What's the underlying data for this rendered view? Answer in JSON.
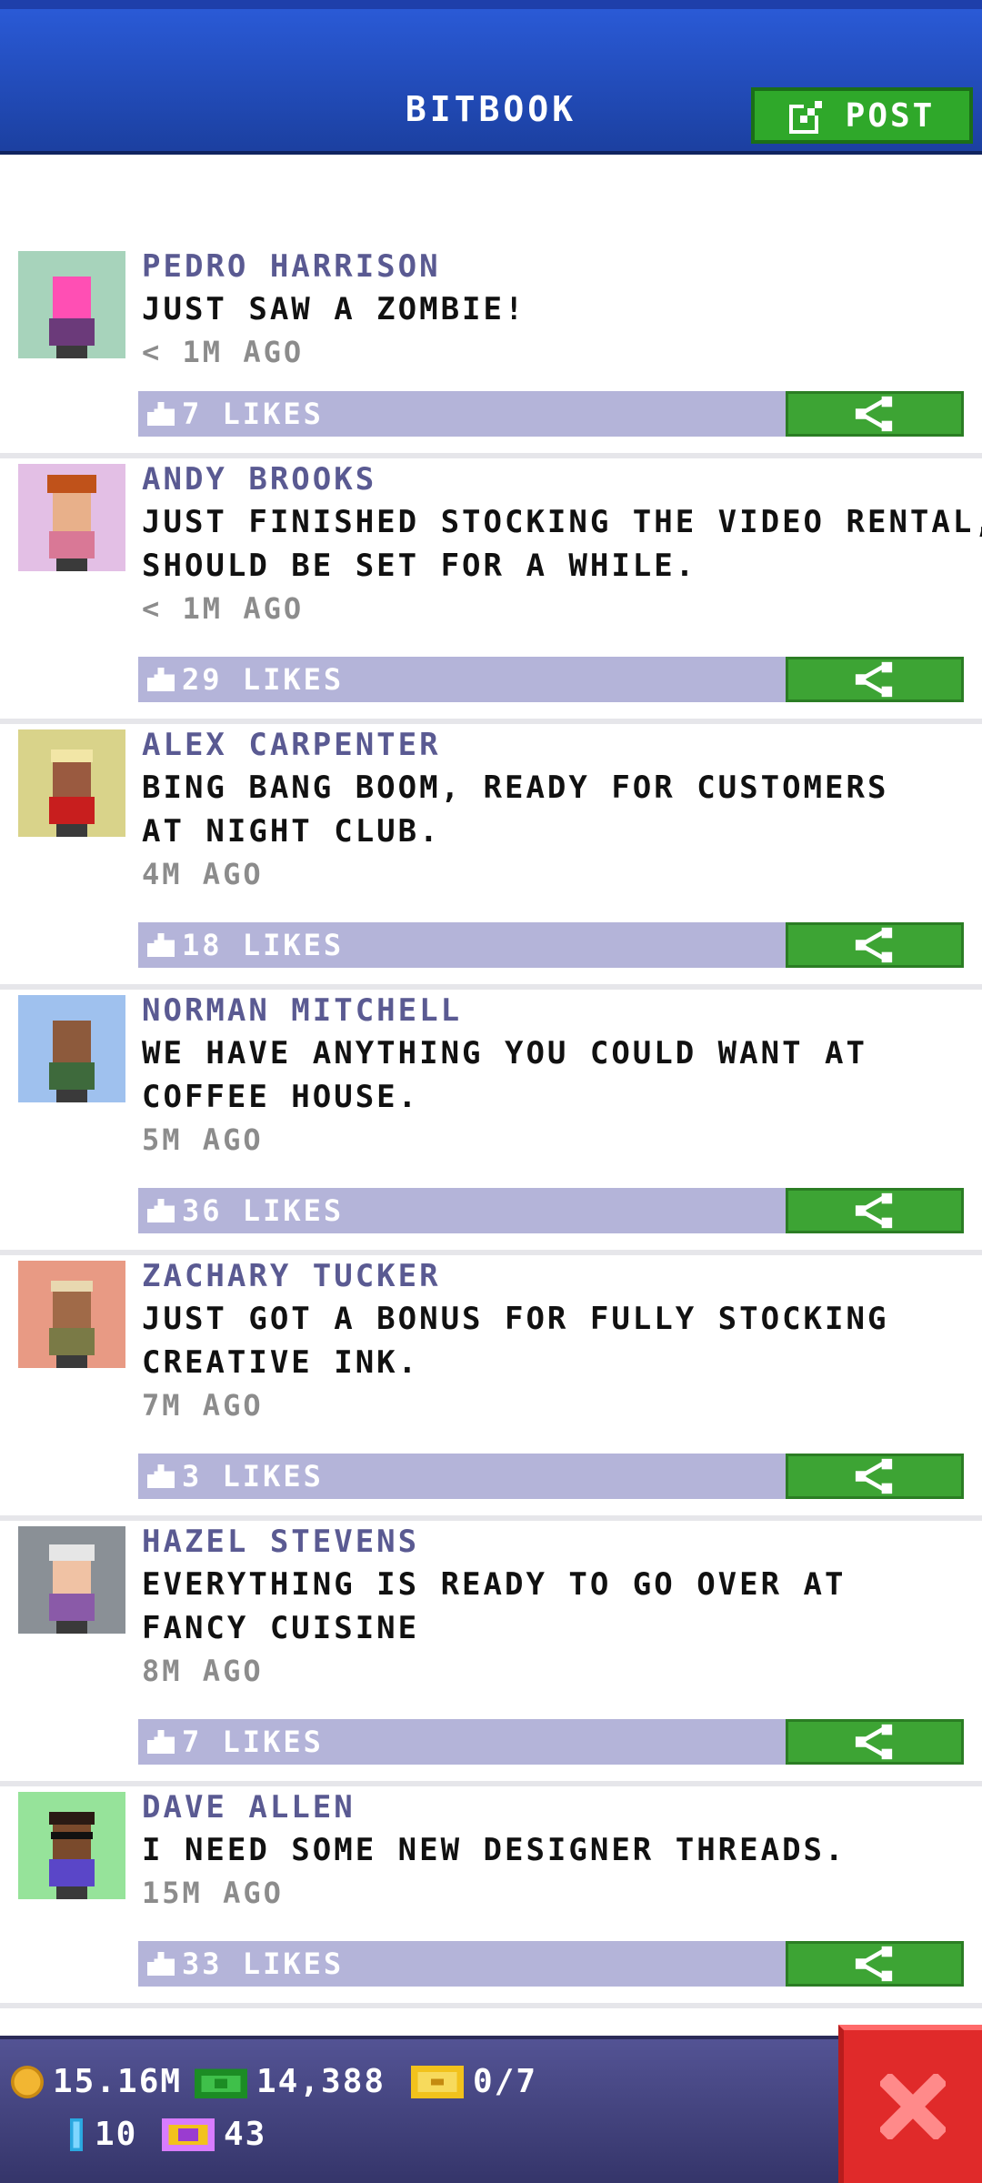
{
  "header": {
    "title": "BITBOOK",
    "post_button_label": "POST",
    "post_icon": "edit-icon"
  },
  "posts": [
    {
      "author": "PEDRO HARRISON",
      "lines": [
        "JUST SAW A ZOMBIE!"
      ],
      "time": "< 1M AGO",
      "likes": "7 LIKES",
      "avatar_bg": "#a7d3bb",
      "hair": "#ff4fb4",
      "skin": "#f4b6a0",
      "shirt": "#6b3a7a"
    },
    {
      "author": "ANDY BROOKS",
      "lines": [
        "JUST FINISHED STOCKING THE VIDEO RENTAL,",
        "SHOULD BE SET FOR A WHILE."
      ],
      "time": "< 1M AGO",
      "likes": "29 LIKES",
      "avatar_bg": "#e3bfe5",
      "hair": "#c0521a",
      "skin": "#e8b08a",
      "shirt": "#d97896"
    },
    {
      "author": "ALEX CARPENTER",
      "lines": [
        "BING BANG BOOM, READY FOR CUSTOMERS",
        "AT NIGHT CLUB."
      ],
      "time": "4M AGO",
      "likes": "18 LIKES",
      "avatar_bg": "#d9d38a",
      "hair": "#f2e6a6",
      "skin": "#9a5a40",
      "shirt": "#c81e1e"
    },
    {
      "author": "NORMAN MITCHELL",
      "lines": [
        "WE HAVE ANYTHING YOU COULD WANT AT",
        "COFFEE HOUSE."
      ],
      "time": "5M AGO",
      "likes": "36 LIKES",
      "avatar_bg": "#9fc1ee",
      "hair": "#7a4a30",
      "skin": "#8d5a3c",
      "shirt": "#3e6a3c"
    },
    {
      "author": "ZACHARY TUCKER",
      "lines": [
        "JUST GOT A BONUS FOR FULLY STOCKING",
        "CREATIVE INK."
      ],
      "time": "7M AGO",
      "likes": "3 LIKES",
      "avatar_bg": "#e89a84",
      "hair": "#e8d8b0",
      "skin": "#a06a48",
      "shirt": "#7a7a46"
    },
    {
      "author": "HAZEL STEVENS",
      "lines": [
        "EVERYTHING IS READY TO GO OVER AT",
        "FANCY CUISINE"
      ],
      "time": "8M AGO",
      "likes": "7 LIKES",
      "avatar_bg": "#8a9096",
      "hair": "#e6e6e6",
      "skin": "#f0c2a4",
      "shirt": "#8a5aa8"
    },
    {
      "author": "DAVE ALLEN",
      "lines": [
        "I NEED SOME NEW DESIGNER THREADS."
      ],
      "time": "15M AGO",
      "likes": "33 LIKES",
      "avatar_bg": "#96e39a",
      "hair": "#2a1a14",
      "skin": "#7a4a2c",
      "shirt": "#5a46c8"
    }
  ],
  "bottom_bar": {
    "coins": "15.16M",
    "cash": "14,388",
    "tickets": "0/7",
    "bux": "10",
    "vip": "43"
  },
  "close_icon": "close-icon"
}
